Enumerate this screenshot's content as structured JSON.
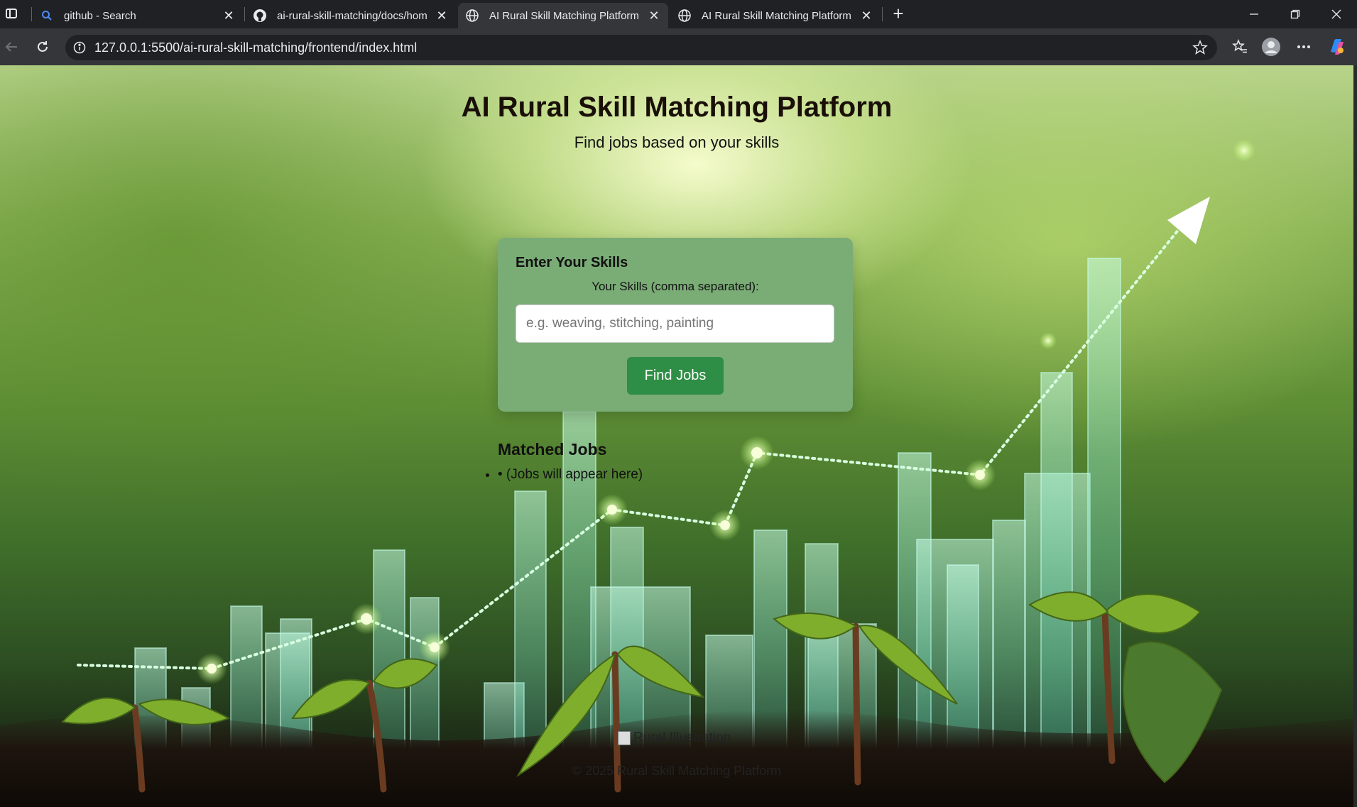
{
  "browser": {
    "tabs": [
      {
        "title": "github - Search",
        "icon": "search-icon",
        "active": false
      },
      {
        "title": "ai-rural-skill-matching/docs/hom",
        "icon": "github-icon",
        "active": false
      },
      {
        "title": "AI Rural Skill Matching Platform",
        "icon": "globe-icon",
        "active": true
      },
      {
        "title": "AI Rural Skill Matching Platform",
        "icon": "globe-icon",
        "active": false
      }
    ],
    "url": "127.0.0.1:5500/ai-rural-skill-matching/frontend/index.html"
  },
  "page": {
    "title": "AI Rural Skill Matching Platform",
    "subtitle": "Find jobs based on your skills",
    "skills_card": {
      "heading": "Enter Your Skills",
      "label": "Your Skills (comma separated):",
      "input_value": "",
      "input_placeholder": "e.g. weaving, stitching, painting",
      "button_label": "Find Jobs"
    },
    "matched_jobs": {
      "heading": "Matched Jobs",
      "items": [
        "• (Jobs will appear here)"
      ]
    },
    "footer": {
      "image_alt": "Rural Illustration",
      "copyright": "© 2025 Rural Skill Matching Platform"
    }
  },
  "colors": {
    "card_bg": "#7aac76",
    "button_bg": "#2f8e45",
    "title_color": "#1a0f08"
  }
}
